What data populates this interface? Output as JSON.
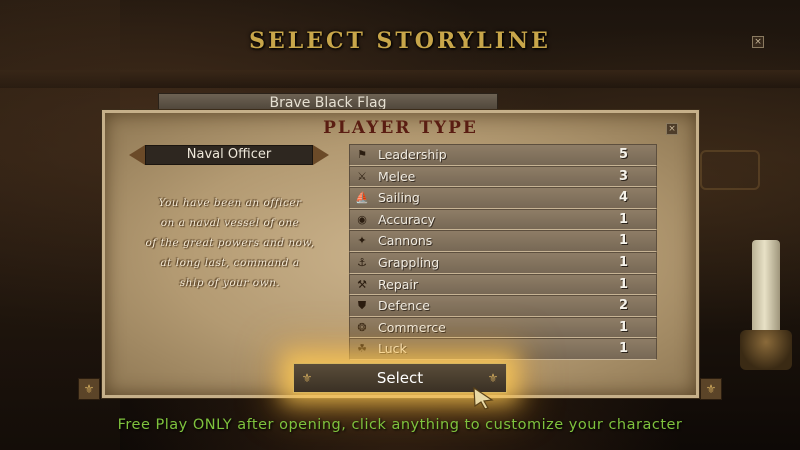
{
  "screen_title": "SELECT STORYLINE",
  "storyline": "Brave Black Flag",
  "panel": {
    "title": "PLAYER TYPE",
    "player_type": "Naval Officer",
    "description_lines": [
      "You have been an officer",
      "on a naval vessel of one",
      "of the great powers and now,",
      "at long last, command a",
      "ship of your own."
    ],
    "skills": [
      {
        "label": "Leadership",
        "value": "5",
        "icon": "flag-icon",
        "glyph": "⚑"
      },
      {
        "label": "Melee",
        "value": "3",
        "icon": "crossed-swords-icon",
        "glyph": "⚔"
      },
      {
        "label": "Sailing",
        "value": "4",
        "icon": "sail-icon",
        "glyph": "⛵"
      },
      {
        "label": "Accuracy",
        "value": "1",
        "icon": "target-icon",
        "glyph": "◉"
      },
      {
        "label": "Cannons",
        "value": "1",
        "icon": "cannon-icon",
        "glyph": "✦"
      },
      {
        "label": "Grappling",
        "value": "1",
        "icon": "grappling-hook-icon",
        "glyph": "⚓"
      },
      {
        "label": "Repair",
        "value": "1",
        "icon": "hammer-icon",
        "glyph": "⚒"
      },
      {
        "label": "Defence",
        "value": "2",
        "icon": "shield-icon",
        "glyph": "⛊"
      },
      {
        "label": "Commerce",
        "value": "1",
        "icon": "coins-icon",
        "glyph": "❂"
      },
      {
        "label": "Luck",
        "value": "1",
        "icon": "clover-icon",
        "glyph": "☘"
      }
    ],
    "select_label": "Select"
  },
  "footer": "Free Play ONLY after opening, click anything to customize your character",
  "colors": {
    "title_gold": "#c8a64a",
    "panel_title": "#5a1d12",
    "footer_green": "#7fc23d",
    "button_glow": "#ffce5a"
  }
}
